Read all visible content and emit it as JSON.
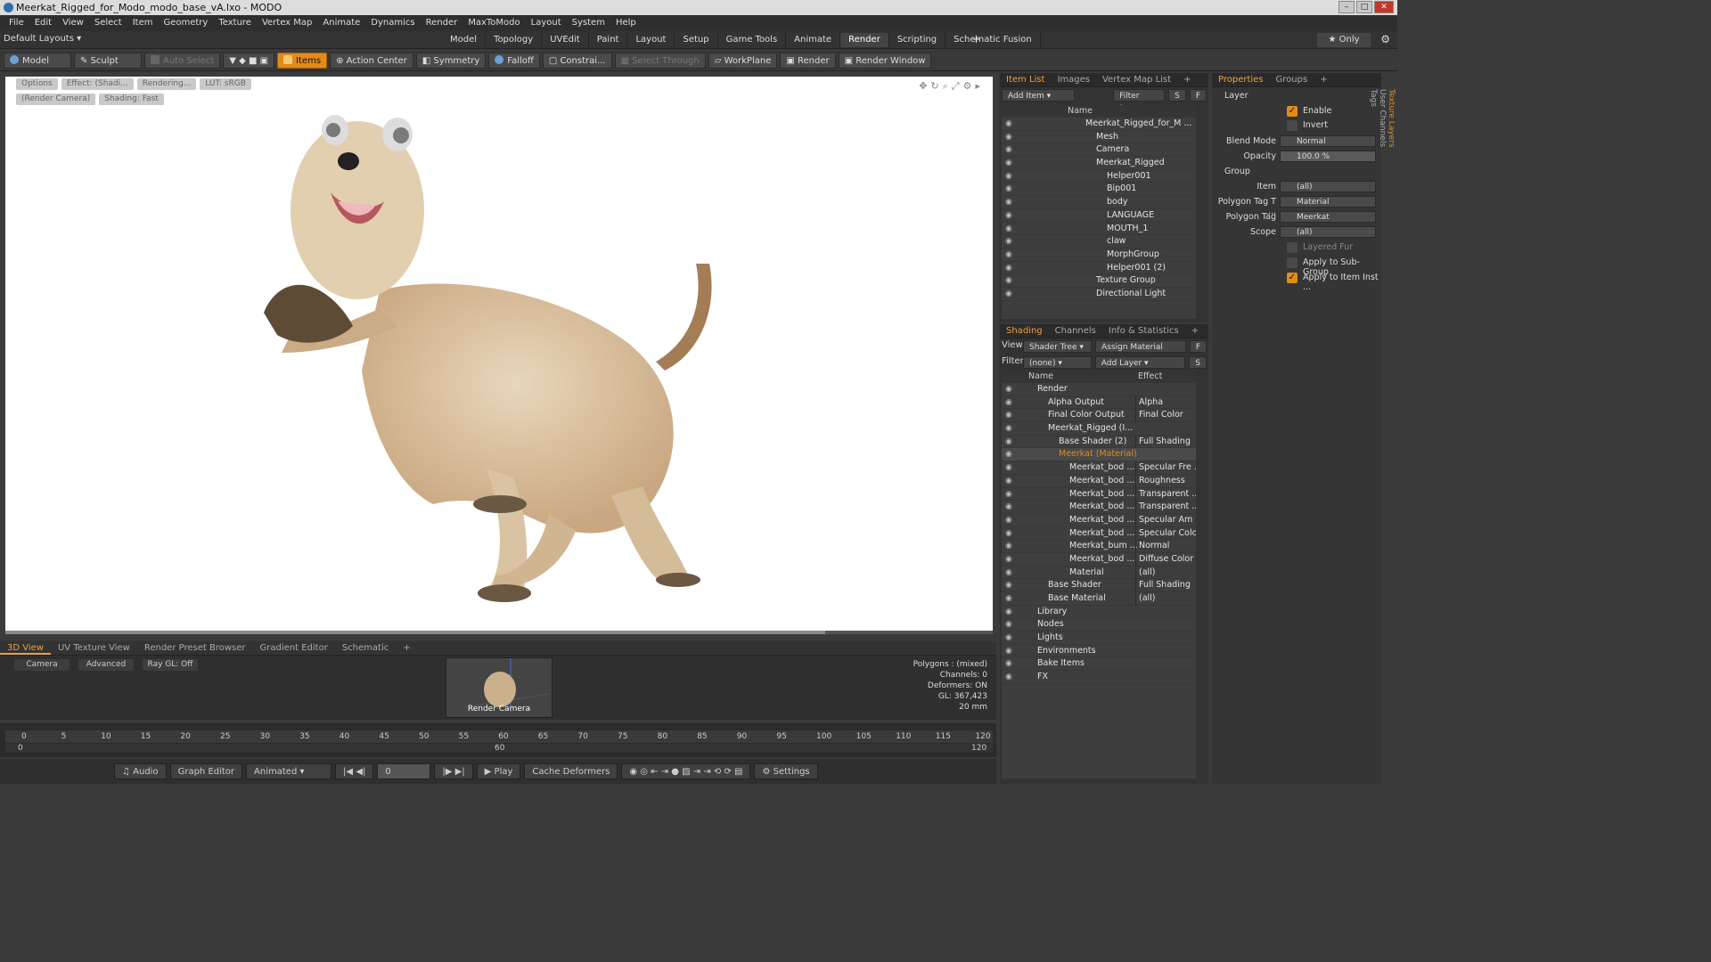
{
  "window": {
    "title": "Meerkat_Rigged_for_Modo_modo_base_vA.lxo - MODO"
  },
  "menu": [
    "File",
    "Edit",
    "View",
    "Select",
    "Item",
    "Geometry",
    "Texture",
    "Vertex Map",
    "Animate",
    "Dynamics",
    "Render",
    "MaxToModo",
    "Layout",
    "System",
    "Help"
  ],
  "layouts": {
    "current": "Default Layouts",
    "tabs": [
      "Model",
      "Topology",
      "UVEdit",
      "Paint",
      "Layout",
      "Setup",
      "Game Tools",
      "Animate",
      "Render",
      "Scripting",
      "Schematic Fusion"
    ],
    "active": "Render",
    "only": "Only"
  },
  "toolbar": [
    "Model",
    "Sculpt",
    "Auto Select",
    "Items",
    "Action Center",
    "Symmetry",
    "Falloff",
    "Constrai...",
    "Select Through",
    "WorkPlane",
    "Render",
    "Render Window"
  ],
  "viewport": {
    "buttons": [
      "Options",
      "Effect: (Shadi...",
      "Rendering...",
      "LUT: sRGB",
      "(Render Camera)",
      "Shading: Fast"
    ]
  },
  "bottom": {
    "tabs": [
      "3D View",
      "UV Texture View",
      "Render Preset Browser",
      "Gradient Editor",
      "Schematic"
    ],
    "opts": [
      "Camera",
      "Advanced",
      "Ray GL: Off"
    ],
    "thumb_label": "Render Camera",
    "stats": [
      "Polygons : (mixed)",
      "Channels: 0",
      "Deformers: ON",
      "GL: 367,423",
      "20 mm"
    ]
  },
  "timeline": {
    "ticks": [
      "0",
      "5",
      "10",
      "15",
      "20",
      "25",
      "30",
      "35",
      "40",
      "45",
      "50",
      "55",
      "60",
      "65",
      "70",
      "75",
      "80",
      "85",
      "90",
      "95",
      "100",
      "105",
      "110",
      "115",
      "120"
    ],
    "sub": [
      "0",
      "60",
      "120"
    ]
  },
  "playbar": {
    "audio": "Audio",
    "graph": "Graph Editor",
    "mode": "Animated",
    "frame": "0",
    "play": "Play",
    "cache": "Cache Deformers",
    "settings": "Settings"
  },
  "itemlist": {
    "tabs": [
      "Item List",
      "Images",
      "Vertex Map List"
    ],
    "add": "Add Item",
    "filter": "Filter Items",
    "s": "S",
    "f": "F",
    "header": "Name",
    "rows": [
      {
        "n": "Meerkat_Rigged_for_M ...",
        "i": 0
      },
      {
        "n": "Mesh",
        "i": 1
      },
      {
        "n": "Camera",
        "i": 1
      },
      {
        "n": "Meerkat_Rigged",
        "i": 1
      },
      {
        "n": "Helper001",
        "i": 2
      },
      {
        "n": "Bip001",
        "i": 2
      },
      {
        "n": "body",
        "i": 2
      },
      {
        "n": "LANGUAGE",
        "i": 2
      },
      {
        "n": "MOUTH_1",
        "i": 2
      },
      {
        "n": "claw",
        "i": 2
      },
      {
        "n": "MorphGroup",
        "i": 2
      },
      {
        "n": "Helper001 (2)",
        "i": 2
      },
      {
        "n": "Texture Group",
        "i": 1
      },
      {
        "n": "Directional Light",
        "i": 1
      }
    ]
  },
  "shading": {
    "tabs": [
      "Shading",
      "Channels",
      "Info & Statistics"
    ],
    "view_label": "View",
    "view": "Shader Tree",
    "assign": "Assign Material",
    "filter_label": "Filter",
    "filter": "(none)",
    "add": "Add Layer",
    "s": "S",
    "f": "F",
    "cols": [
      "Name",
      "Effect"
    ],
    "rows": [
      {
        "n": "Render",
        "e": "",
        "i": 0
      },
      {
        "n": "Alpha Output",
        "e": "Alpha",
        "i": 1
      },
      {
        "n": "Final Color Output",
        "e": "Final Color",
        "i": 1
      },
      {
        "n": "Meerkat_Rigged (I...",
        "e": "",
        "i": 1
      },
      {
        "n": "Base Shader (2)",
        "e": "Full Shading",
        "i": 2
      },
      {
        "n": "Meerkat (Material)",
        "e": "",
        "i": 2
      },
      {
        "n": "Meerkat_bod ...",
        "e": "Specular Fre ...",
        "i": 3
      },
      {
        "n": "Meerkat_bod ...",
        "e": "Roughness",
        "i": 3
      },
      {
        "n": "Meerkat_bod ...",
        "e": "Transparent ...",
        "i": 3
      },
      {
        "n": "Meerkat_bod ...",
        "e": "Transparent ...",
        "i": 3
      },
      {
        "n": "Meerkat_bod ...",
        "e": "Specular Am ...",
        "i": 3
      },
      {
        "n": "Meerkat_bod ...",
        "e": "Specular Color",
        "i": 3
      },
      {
        "n": "Meerkat_bum ...",
        "e": "Normal",
        "i": 3
      },
      {
        "n": "Meerkat_bod ...",
        "e": "Diffuse Color",
        "i": 3
      },
      {
        "n": "Material",
        "e": "(all)",
        "i": 3
      },
      {
        "n": "Base Shader",
        "e": "Full Shading",
        "i": 1
      },
      {
        "n": "Base Material",
        "e": "(all)",
        "i": 1
      },
      {
        "n": "Library",
        "e": "",
        "i": 0
      },
      {
        "n": "Nodes",
        "e": "",
        "i": 0
      },
      {
        "n": "Lights",
        "e": "",
        "i": 0
      },
      {
        "n": "Environments",
        "e": "",
        "i": 0
      },
      {
        "n": "Bake Items",
        "e": "",
        "i": 0
      },
      {
        "n": "FX",
        "e": "",
        "i": 0
      }
    ]
  },
  "properties": {
    "tabs": [
      "Properties",
      "Groups"
    ],
    "layer": "Layer",
    "enable": "Enable",
    "invert": "Invert",
    "blend_label": "Blend Mode",
    "blend": "Normal",
    "opacity_label": "Opacity",
    "opacity": "100.0 %",
    "group": "Group",
    "item_label": "Item",
    "item": "(all)",
    "ptt_label": "Polygon Tag T ...",
    "ptt": "Material",
    "pt_label": "Polygon Tag",
    "pt": "Meerkat",
    "scope_label": "Scope",
    "scope": "(all)",
    "fur": "Layered Fur",
    "sub": "Apply to Sub-Group",
    "inst": "Apply to Item Inst ...",
    "side": [
      "Texture Layers",
      "User Channels",
      "Tags"
    ]
  },
  "colors": {
    "accent": "#e48a18"
  }
}
